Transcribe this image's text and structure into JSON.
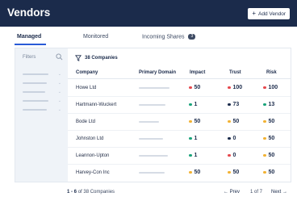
{
  "header": {
    "title": "Vendors",
    "add_button_icon": "plus-icon",
    "add_button_label": "Add Vendor"
  },
  "tabs": [
    {
      "label": "Managed",
      "active": true
    },
    {
      "label": "Monitored",
      "active": false
    },
    {
      "label": "Incoming Shares",
      "active": false,
      "badge": "3"
    }
  ],
  "sidebar": {
    "label": "Filters",
    "search_icon": "search-icon"
  },
  "list": {
    "filter_icon": "filter-icon",
    "count_label": "38 Companies",
    "columns": {
      "company": "Company",
      "domain": "Primary Domain",
      "impact": "Impact",
      "trust": "Trust",
      "risk": "Risk"
    },
    "rows": [
      {
        "company": "Howe Ltd",
        "impact": "50",
        "trust": "100",
        "risk": "100"
      },
      {
        "company": "Hartmann-Wuckert",
        "impact": "1",
        "trust": "73",
        "risk": "13"
      },
      {
        "company": "Bode Ltd",
        "impact": "50",
        "trust": "50",
        "risk": "50"
      },
      {
        "company": "Johnston Ltd",
        "impact": "1",
        "trust": "0",
        "risk": "50"
      },
      {
        "company": "Leannon-Upton",
        "impact": "1",
        "trust": "0",
        "risk": "50"
      },
      {
        "company": "Harvey-Con Inc",
        "impact": "50",
        "trust": "50",
        "risk": "50"
      }
    ]
  },
  "footer": {
    "range": "1 - 6",
    "of_total": "of 38 Companies",
    "prev": "← Prev",
    "page_of": "1 of 7",
    "next": "Next →"
  },
  "colors": {
    "header_bg": "#1b2b4b",
    "accent": "#2a5bd7",
    "red": "#e5484d",
    "green": "#1aa37a",
    "yellow": "#f2b233",
    "navy": "#1b2b4b"
  }
}
